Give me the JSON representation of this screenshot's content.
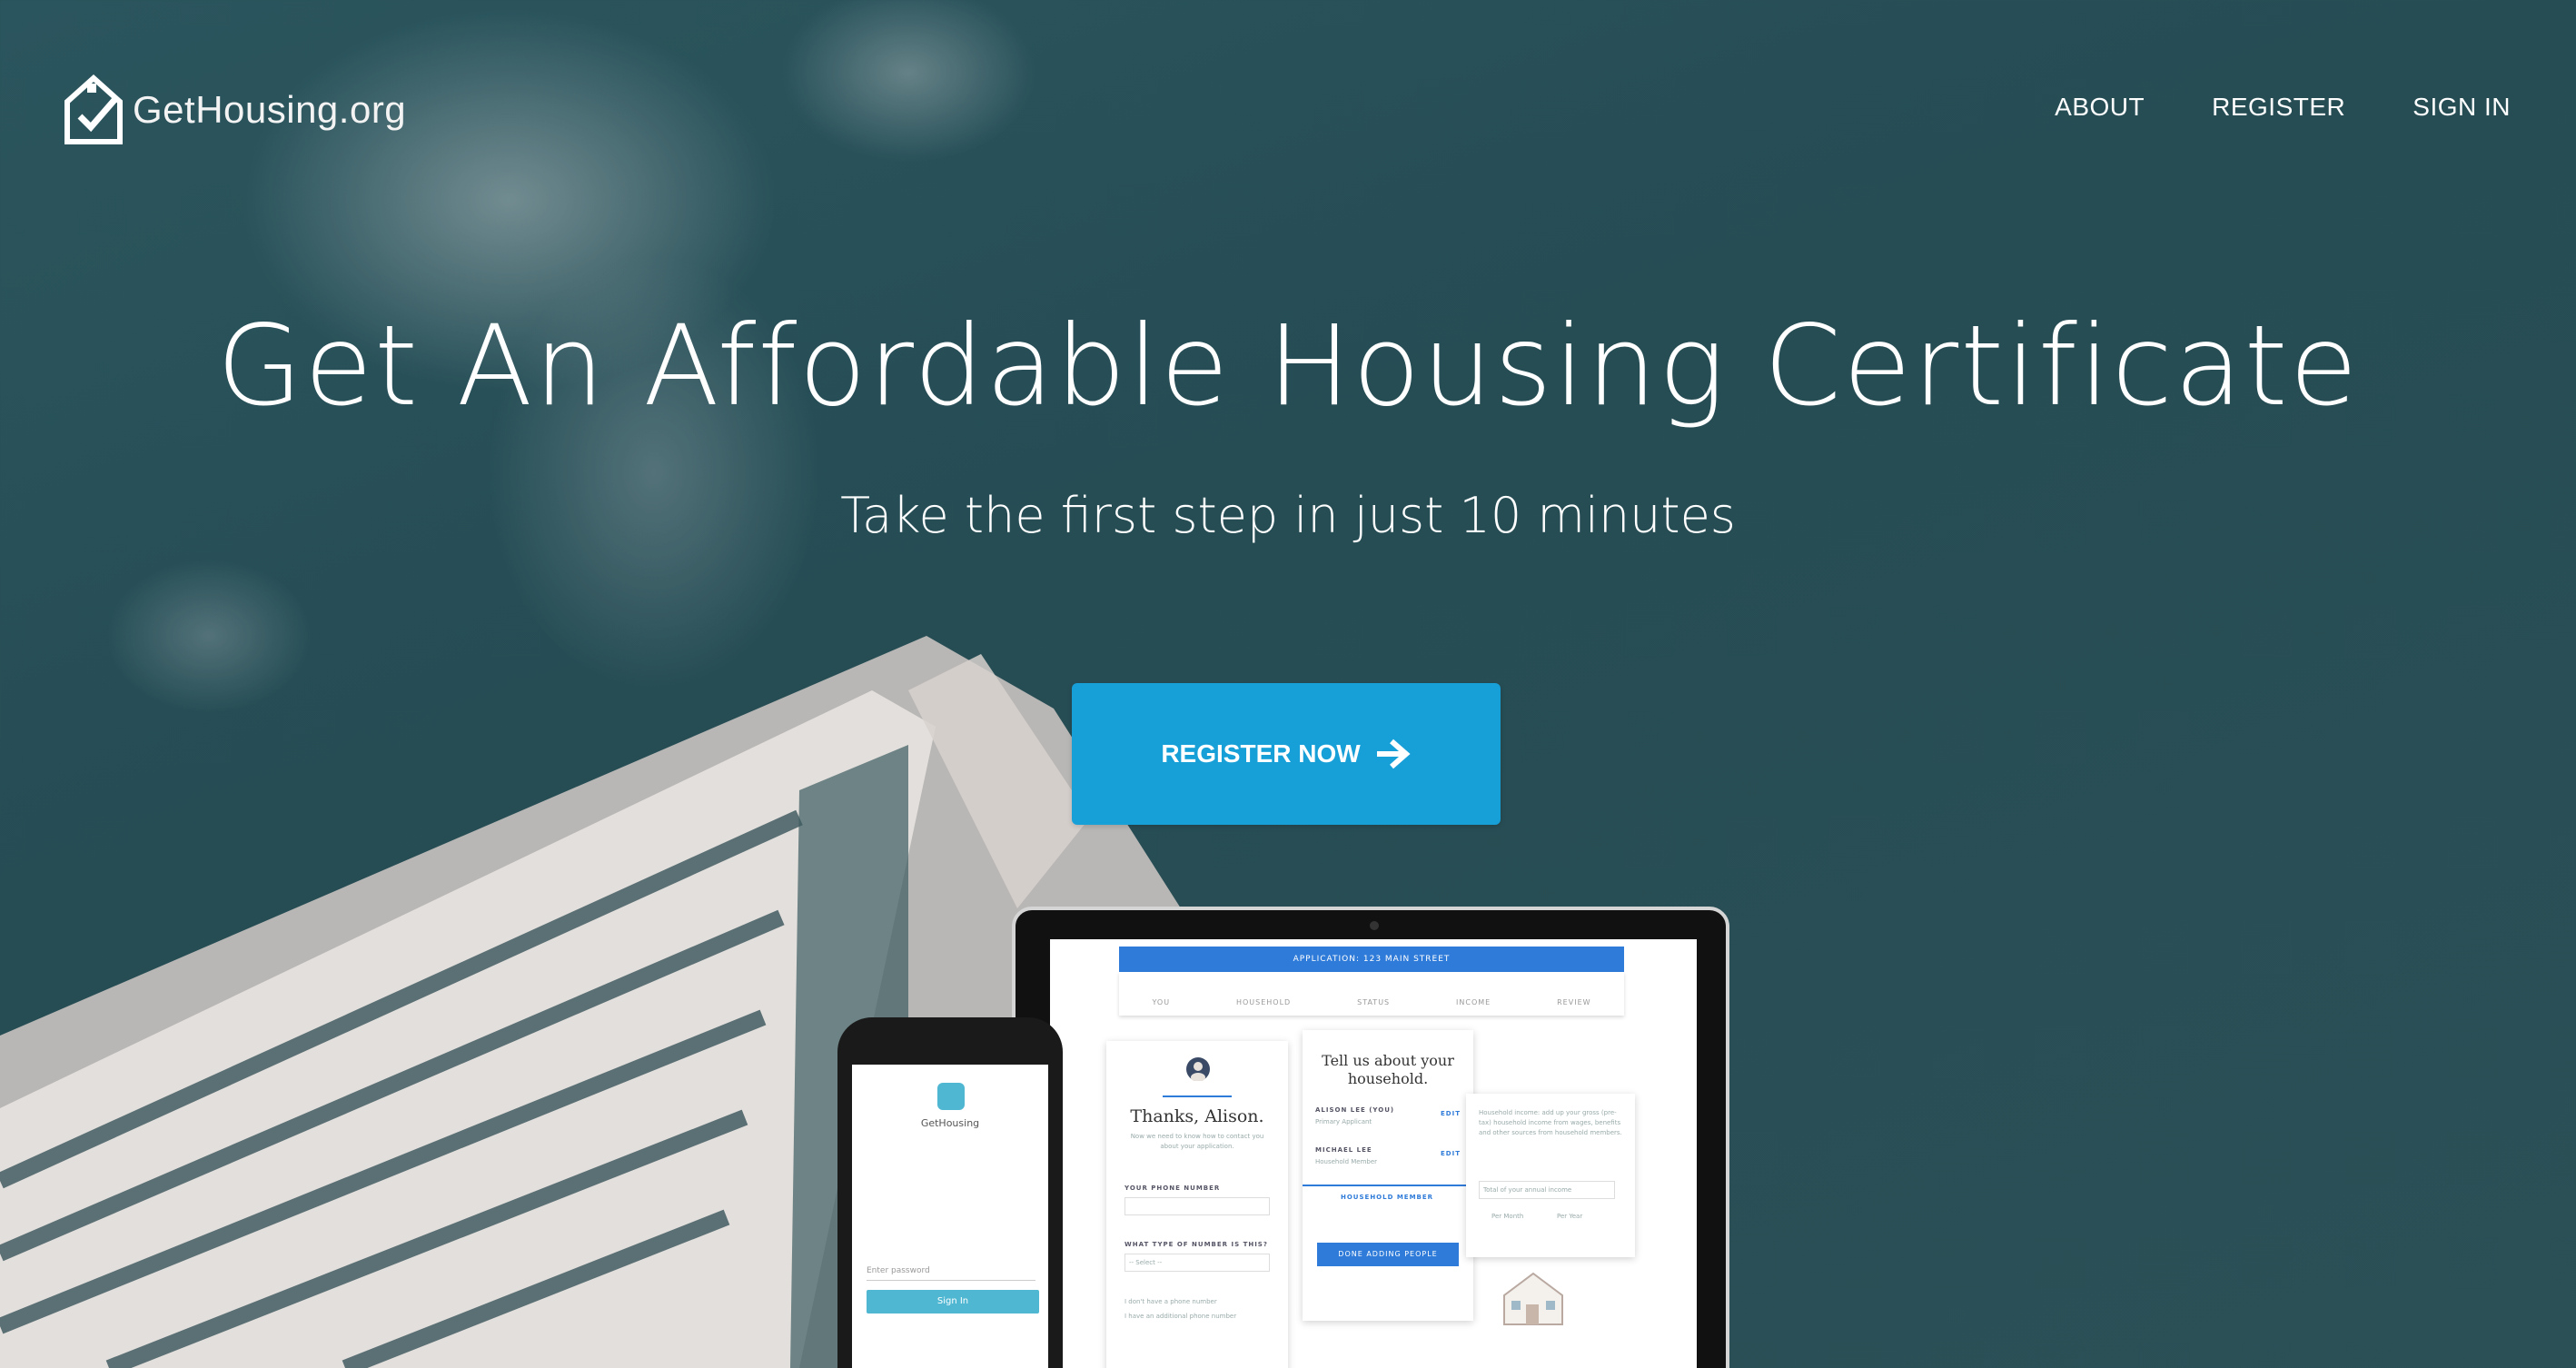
{
  "brand": {
    "name": "GetHousing.org"
  },
  "nav": {
    "about": "ABOUT",
    "register": "REGISTER",
    "sign_in": "SIGN IN"
  },
  "hero": {
    "title": "Get An Affordable Housing Certificate",
    "subtitle": "Take the first step in just 10 minutes",
    "cta_label": "REGISTER NOW"
  },
  "laptop_mock": {
    "app_bar": "APPLICATION: 123 MAIN STREET",
    "steps": [
      "YOU",
      "HOUSEHOLD",
      "STATUS",
      "INCOME",
      "REVIEW"
    ],
    "card1": {
      "heading": "Thanks, Alison.",
      "intro": "Now we need to know how to contact you about your application.",
      "phone_label": "YOUR PHONE NUMBER",
      "type_label": "WHAT TYPE OF NUMBER IS THIS?",
      "select_placeholder": "-- Select --",
      "check1": "I don't have a phone number",
      "check2": "I have an additional phone number"
    },
    "card2": {
      "heading": "Tell us about your household.",
      "member1_name": "ALISON LEE (YOU)",
      "member1_role": "Primary Applicant",
      "member2_name": "MICHAEL LEE",
      "member2_role": "Household Member",
      "edit": "EDIT",
      "add_member": "HOUSEHOLD MEMBER",
      "done": "DONE ADDING PEOPLE"
    },
    "card3": {
      "text": "Household income: add up your gross (pre-tax) household income from wages, benefits and other sources from household members.",
      "input_placeholder": "Total of your annual income",
      "per_month": "Per Month",
      "per_year": "Per Year"
    }
  },
  "phone_mock": {
    "app_name": "GetHousing",
    "password_placeholder": "Enter password",
    "sign_in": "Sign In"
  },
  "colors": {
    "accent": "#17a0d8",
    "app_blue": "#2f7bd9",
    "background": "#2d5660"
  }
}
